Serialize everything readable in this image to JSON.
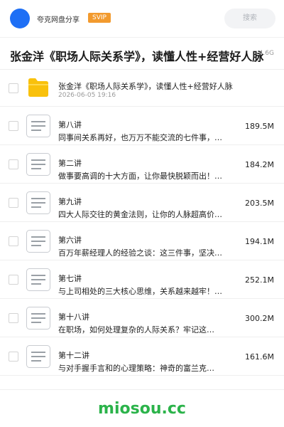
{
  "header": {
    "user_name": "夸克网盘分享",
    "vip_label": "SVIP",
    "search_placeholder": "搜索"
  },
  "title_bar": {
    "title": "张金洋《职场人际关系学》，读懂人性+经营好人脉",
    "meta": "4.6G"
  },
  "folder": {
    "name": "张金洋《职场人际关系学》，读懂人性+经营好人脉",
    "date": "2026-06-05 19:16"
  },
  "files": [
    {
      "title": "第八讲",
      "name": "同事间关系再好，也万万不能交流的七件事，…",
      "size": "189.5M"
    },
    {
      "title": "第二讲",
      "name": "做事要高调的十大方面，让你最快脱颖而出！…",
      "size": "184.2M"
    },
    {
      "title": "第九讲",
      "name": "四大人际交往的黄金法则，让你的人脉超高价…",
      "size": "203.5M"
    },
    {
      "title": "第六讲",
      "name": "百万年薪经理人的经验之谈：这三件事，坚决…",
      "size": "194.1M"
    },
    {
      "title": "第七讲",
      "name": "与上司相处的三大核心思维，关系越来越牢！…",
      "size": "252.1M"
    },
    {
      "title": "第十八讲",
      "name": "在职场，如何处理复杂的人际关系？牢记这…",
      "size": "300.2M"
    },
    {
      "title": "第十二讲",
      "name": "与对手握手言和的心理策略：神奇的富兰克…",
      "size": "161.6M"
    }
  ],
  "watermark": "miosou.cc",
  "colors": {
    "avatar": "#1e6ff5",
    "vip_badge": "#f29a2e",
    "folder_icon": "#f9c10c",
    "watermark": "#2bb34a"
  }
}
